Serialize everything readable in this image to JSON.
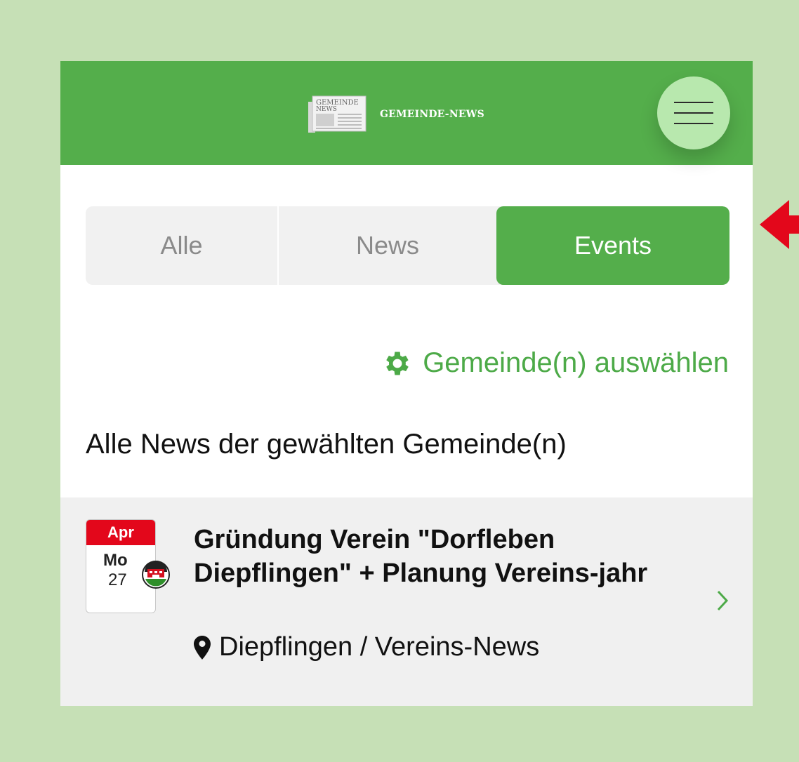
{
  "header": {
    "logo_badge_line1": "GEMEINDE",
    "logo_badge_line2": "NEWS",
    "logo_text": "GEMEINDE-NEWS",
    "menu_icon": "hamburger-icon"
  },
  "tabs": [
    {
      "label": "Alle",
      "selected": false
    },
    {
      "label": "News",
      "selected": false
    },
    {
      "label": "Events",
      "selected": true
    }
  ],
  "filter": {
    "icon": "gear-icon",
    "label": "Gemeinde(n) auswählen"
  },
  "section_title": "Alle News der gewählten Gemeinde(n)",
  "items": [
    {
      "month": "Apr",
      "weekday": "Mo",
      "day": "27",
      "title": "Gründung Verein \"Dorfleben Diepflingen\" + Planung Vereins-jahr",
      "location": "Diepflingen / Vereins-News",
      "crest_icon": "municipality-crest-icon",
      "pin_icon": "map-pin-icon",
      "chevron_icon": "chevron-right-icon"
    }
  ],
  "colors": {
    "brand_green": "#54ae4b",
    "menu_green": "#b8e8ae",
    "background": "#c6e0b6",
    "date_red": "#e3071b",
    "annotation_arrow": "#e3071b"
  }
}
